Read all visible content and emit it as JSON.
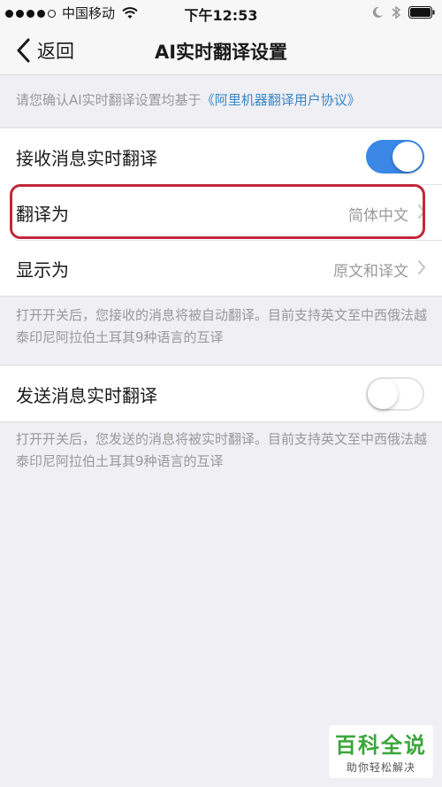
{
  "status_bar": {
    "carrier": "中国移动",
    "time": "下午12:53",
    "signal_dots": 4,
    "signal_total": 5
  },
  "nav": {
    "back_label": "返回",
    "title": "AI实时翻译设置"
  },
  "notice": {
    "prefix": "请您确认AI实时翻译设置均基于",
    "link": "《阿里机器翻译用户协议》",
    "link_color": "#3a87c7"
  },
  "receive_group": {
    "toggle_label": "接收消息实时翻译",
    "toggle_on": true,
    "translate_to_label": "翻译为",
    "translate_to_value": "简体中文",
    "display_as_label": "显示为",
    "display_as_value": "原文和译文",
    "description": "打开开关后，您接收的消息将被自动翻译。目前支持英文至中西俄法越泰印尼阿拉伯土耳其9种语言的互译"
  },
  "send_group": {
    "toggle_label": "发送消息实时翻译",
    "toggle_on": false,
    "description": "打开开关后，您发送的消息将被实时翻译。目前支持英文至中西俄法越泰印尼阿拉伯土耳其9种语言的互译"
  },
  "colors": {
    "accent": "#3a87e6",
    "highlight": "#c0283a",
    "watermark_green": "#3ca63c"
  },
  "watermark": {
    "main": "百科全说",
    "sub": "助你轻松解决"
  }
}
